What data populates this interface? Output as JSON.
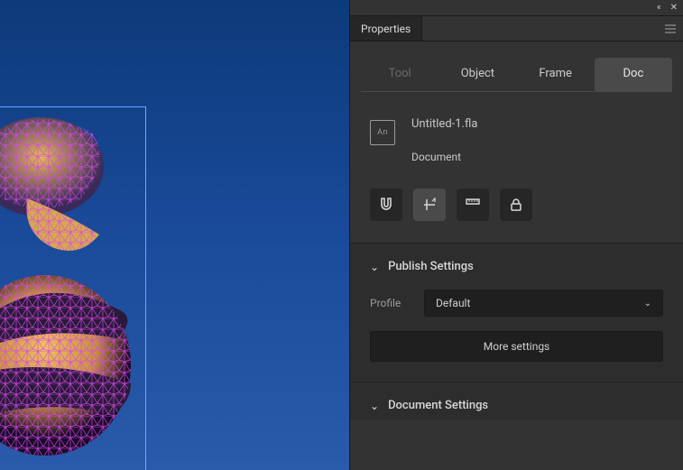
{
  "panel": {
    "title": "Properties",
    "subtabs": {
      "tool": "Tool",
      "object": "Object",
      "frame": "Frame",
      "doc": "Doc"
    }
  },
  "doc": {
    "icon_label": "An",
    "filename": "Untitled-1.fla",
    "type": "Document"
  },
  "toolbuttons": {
    "snap": "snap-icon",
    "guides": "guides-icon",
    "ruler": "ruler-icon",
    "lock": "lock-icon"
  },
  "publish": {
    "title": "Publish Settings",
    "profile_label": "Profile",
    "profile_value": "Default",
    "more_button": "More settings"
  },
  "docsettings": {
    "title": "Document Settings"
  }
}
